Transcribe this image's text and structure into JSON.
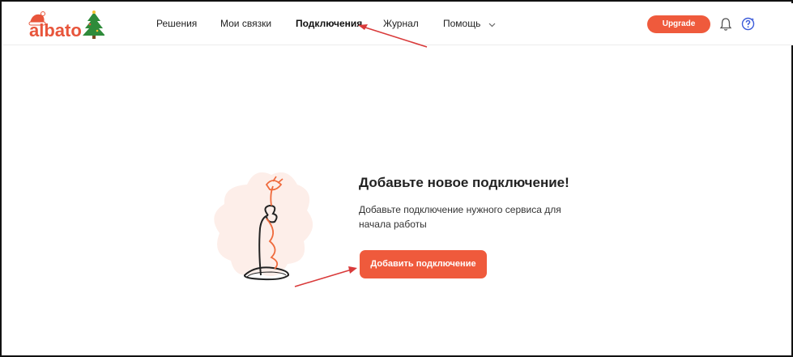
{
  "header": {
    "logo_text": "albato",
    "nav": [
      {
        "label": "Решения"
      },
      {
        "label": "Мои связки"
      },
      {
        "label": "Подключения"
      },
      {
        "label": "Журнал"
      },
      {
        "label": "Помощь"
      }
    ],
    "upgrade_label": "Upgrade",
    "icons": {
      "bell": "bell-icon",
      "help": "question-sparkle-icon",
      "dropdown": "chevron-down-icon"
    }
  },
  "main": {
    "title": "Добавьте новое подключение!",
    "description": "Добавьте подключение нужного сервиса для начала работы",
    "add_button_label": "Добавить подключение"
  },
  "colors": {
    "accent": "#ef5a3c",
    "annotation_arrow": "#d93a3a"
  }
}
